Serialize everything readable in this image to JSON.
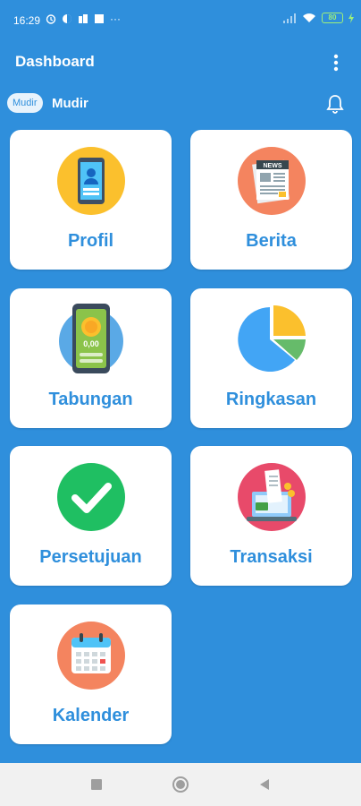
{
  "status_bar": {
    "time": "16:29",
    "more": "···",
    "battery": "80"
  },
  "app_bar": {
    "title": "Dashboard"
  },
  "role": {
    "badge": "Mudir",
    "name": "Mudir"
  },
  "cards": [
    {
      "label": "Profil",
      "icon": "profile-phone-icon"
    },
    {
      "label": "Berita",
      "icon": "news-icon",
      "icon_text": "NEWS"
    },
    {
      "label": "Tabungan",
      "icon": "savings-wallet-icon",
      "icon_text": "0,00"
    },
    {
      "label": "Ringkasan",
      "icon": "pie-chart-icon"
    },
    {
      "label": "Persetujuan",
      "icon": "approval-check-icon"
    },
    {
      "label": "Transaksi",
      "icon": "transaction-icon"
    },
    {
      "label": "Kalender",
      "icon": "calendar-icon"
    }
  ],
  "colors": {
    "primary": "#2f8fdc",
    "card": "#ffffff",
    "label": "#2f8fdc"
  }
}
